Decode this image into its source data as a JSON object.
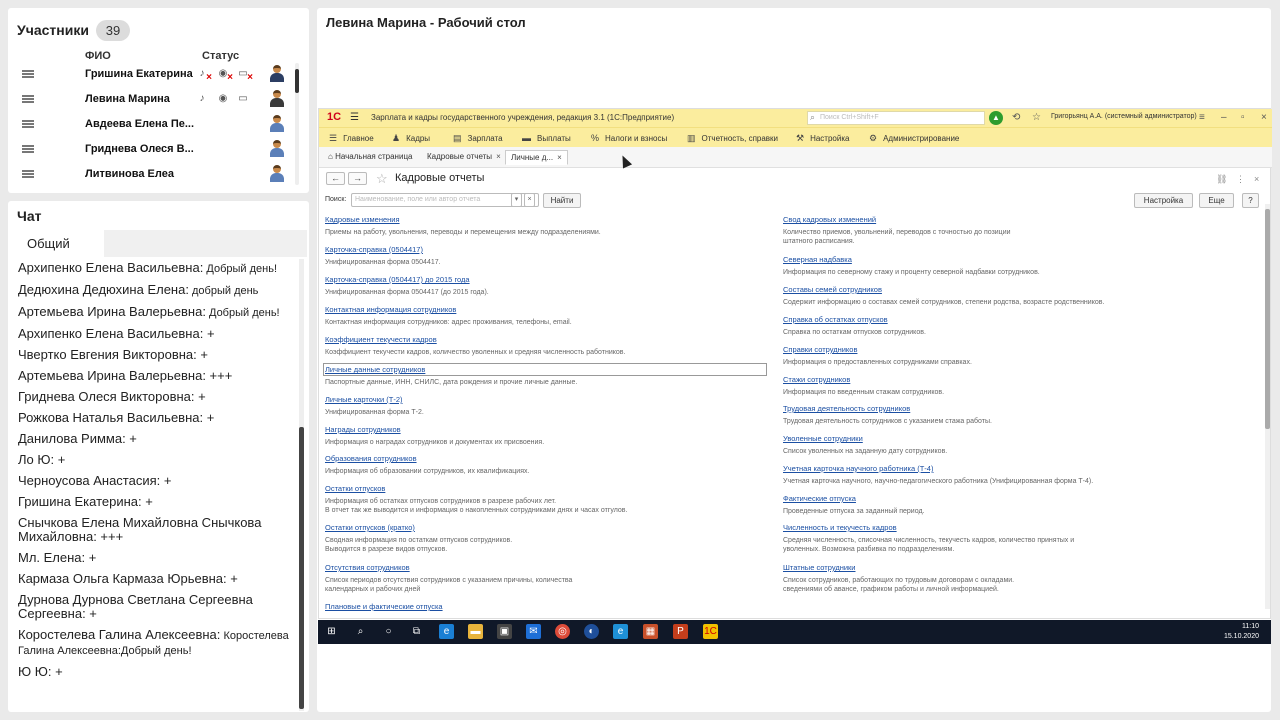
{
  "participants": {
    "title": "Участники",
    "count": "39",
    "col_name": "ФИО",
    "col_status": "Статус",
    "rows": [
      {
        "name": "Гришина Екатерина"
      },
      {
        "name": "Левина Марина"
      },
      {
        "name": "Авдеева Елена   Пе..."
      },
      {
        "name": "Гриднева Олеся   В..."
      },
      {
        "name": "Литвинова Елеа"
      }
    ]
  },
  "chat": {
    "title": "Чат",
    "tab": "Общий",
    "messages": [
      {
        "author": "Архипенко Елена Васильевна:",
        "text": " Добрый день!"
      },
      {
        "author": "Дедюхина  Дедюхина Елена:",
        "text": " добрый день"
      },
      {
        "author": "Артемьева Ирина  Валерьевна:",
        "text": " Добрый день!"
      },
      {
        "author": "Архипенко Елена Васильевна: +",
        "text": ""
      },
      {
        "author": "Чвертко Евгения   Викторовна: +",
        "text": ""
      },
      {
        "author": "Артемьева Ирина  Валерьевна: +++",
        "text": ""
      },
      {
        "author": "Гриднева Олеся  Викторовна: +",
        "text": ""
      },
      {
        "author": "Рожкова Наталья Васильевна: +",
        "text": ""
      },
      {
        "author": "Данилова Римма: +",
        "text": ""
      },
      {
        "author": "Ло Ю: +",
        "text": ""
      },
      {
        "author": "Черноусова Анастасия: +",
        "text": ""
      },
      {
        "author": "Гришина Екатерина: +",
        "text": ""
      },
      {
        "author": "Снычкова Елена Михайловна Снычкова Михайловна: +++",
        "text": ""
      },
      {
        "author": "Мл. Елена: +",
        "text": ""
      },
      {
        "author": "Кармаза Ольга Кармаза  Юрьевна: +",
        "text": ""
      },
      {
        "author": "Дурнова  Дурнова Светлана Сергеевна Сергеевна: +",
        "text": ""
      },
      {
        "author": "Коростелева Галина Алексеевна:",
        "text": " Коростелева Галина Алексеевна:Добрый день!"
      },
      {
        "author": "Ю Ю: +",
        "text": ""
      }
    ]
  },
  "desk": {
    "title": "Левина Марина - Рабочий стол"
  },
  "onec": {
    "app_title": "Зарплата и кадры государственного учреждения, редакция 3.1  (1С:Предприятие)",
    "search_placeholder": "Поиск Ctrl+Shift+F",
    "user": "Григорьянц А.А. (системный администратор)",
    "nav": [
      "Главное",
      "Кадры",
      "Зарплата",
      "Выплаты",
      "Налоги и взносы",
      "Отчетность, справки",
      "Настройка",
      "Администрирование"
    ],
    "tabs": [
      "Начальная страница",
      "Кадровые отчеты",
      "Личные д..."
    ],
    "form_title": "Кадровые отчеты",
    "search_label": "Поиск:",
    "search_box_placeholder": "Наименование, поле или автор отчета",
    "find_button": "Найти",
    "settings_button": "Настройка",
    "more_button": "Еще",
    "help_button": "?",
    "reports_left": [
      {
        "name": "Кадровые изменения",
        "desc": "Приемы на работу, увольнения, переводы и перемещения между подразделениями."
      },
      {
        "name": "Карточка-справка (0504417)",
        "desc": "Унифицированная форма 0504417."
      },
      {
        "name": "Карточка-справка (0504417) до 2015 года",
        "desc": "Унифицированная форма 0504417 (до 2015 года)."
      },
      {
        "name": "Контактная информация сотрудников",
        "desc": "Контактная информация сотрудников: адрес проживания, телефоны, email."
      },
      {
        "name": "Коэффициент текучести кадров",
        "desc": "Коэффициент текучести кадров, количество уволенных и средняя численность работников."
      },
      {
        "name": "Личные данные сотрудников",
        "desc": "Паспортные данные, ИНН, СНИЛС, дата рождения и прочие личные данные."
      },
      {
        "name": "Личные карточки (Т-2)",
        "desc": "Унифицированная форма Т-2."
      },
      {
        "name": "Награды сотрудников",
        "desc": "Информация о наградах сотрудников и документах их присвоения."
      },
      {
        "name": "Образования сотрудников",
        "desc": "Информация об образовании сотрудников, их квалификациях."
      },
      {
        "name": "Остатки отпусков",
        "desc": "Информация об остатках отпусков сотрудников в разрезе рабочих лет.\nВ отчет так же выводится и информация о накопленных сотрудниками днях и часах отгулов."
      },
      {
        "name": "Остатки отпусков (кратко)",
        "desc": "Сводная информация по остаткам отпусков сотрудников.\nВыводится в разрезе видов отпусков."
      },
      {
        "name": "Отсутствия сотрудников",
        "desc": "Список периодов отсутствия сотрудников с указанием причины, количества\nкалендарных и рабочих дней"
      },
      {
        "name": "Плановые и фактические отпуска",
        "desc": ""
      }
    ],
    "reports_right": [
      {
        "name": "Свод кадровых изменений",
        "desc": "Количество приемов, увольнений, переводов с точностью до позиции\nштатного расписания."
      },
      {
        "name": "Северная надбавка",
        "desc": "Информация по северному стажу и проценту северной надбавки сотрудников."
      },
      {
        "name": "Составы семей сотрудников",
        "desc": "Содержит информацию о составах семей сотрудников, степени родства, возрасте родственников."
      },
      {
        "name": "Справка об остатках отпусков",
        "desc": "Справка по остаткам отпусков сотрудников."
      },
      {
        "name": "Справки сотрудников",
        "desc": "Информация о предоставленных сотрудниками справках."
      },
      {
        "name": "Стажи сотрудников",
        "desc": "Информация по введенным стажам сотрудников."
      },
      {
        "name": "Трудовая деятельность сотрудников",
        "desc": "Трудовая деятельность сотрудников с указанием стажа работы."
      },
      {
        "name": "Уволенные сотрудники",
        "desc": "Список уволенных на заданную дату сотрудников."
      },
      {
        "name": "Учетная карточка научного работника (Т-4)",
        "desc": "Учетная карточка научного, научно-педагогического работника (Унифицированная форма Т-4)."
      },
      {
        "name": "Фактические отпуска",
        "desc": "Проведенные отпуска за заданный период."
      },
      {
        "name": "Численность и текучесть кадров",
        "desc": "Средняя численность, списочная численность, текучесть кадров, количество принятых и\nуволенных. Возможна разбивка по подразделениям."
      },
      {
        "name": "Штатные сотрудники",
        "desc": "Список сотрудников, работающих по трудовым договорам с окладами.\nсведениями об авансе, графиком работы и личной информацией."
      }
    ]
  },
  "taskbar": {
    "time": "11:10",
    "date": "15.10.2020"
  }
}
